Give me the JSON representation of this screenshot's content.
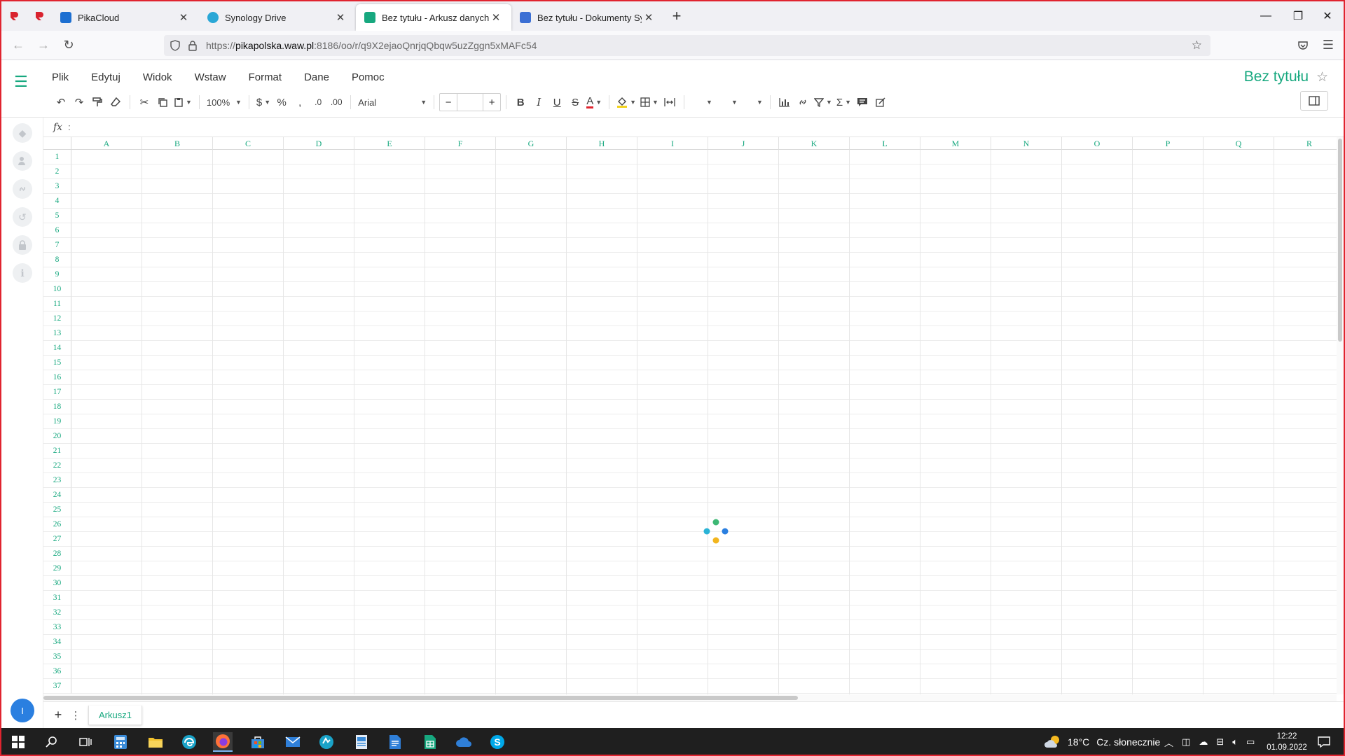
{
  "browser": {
    "tabs": [
      {
        "title": "PikaCloud",
        "fav_color": "#1d6fd1",
        "active": false
      },
      {
        "title": "Synology Drive",
        "fav_color": "#2aa7d6",
        "active": false
      },
      {
        "title": "Bez tytułu - Arkusz danych Synology",
        "fav_color": "#17a87f",
        "active": true
      },
      {
        "title": "Bez tytułu - Dokumenty Synology",
        "fav_color": "#3b6fd4",
        "active": false
      }
    ],
    "url_prefix": "https://",
    "url_host": "pikapolska.waw.pl",
    "url_rest": ":8186/oo/r/q9X2ejaoQnrjqQbqw5uzZggn5xMAFc54"
  },
  "app": {
    "menu": [
      "Plik",
      "Edytuj",
      "Widok",
      "Wstaw",
      "Format",
      "Dane",
      "Pomoc"
    ],
    "doc_title": "Bez tytułu",
    "accent_color": "#17a87f",
    "toolbar": {
      "zoom": "100%",
      "currency": "$",
      "percent": "%",
      "comma": ",",
      "dec_decrease": ".0",
      "dec_increase": ".00",
      "font": "Arial",
      "font_size": ""
    },
    "formula": {
      "label": "fx",
      "colon": ":"
    },
    "columns": [
      "A",
      "B",
      "C",
      "D",
      "E",
      "F",
      "G",
      "H",
      "I",
      "J",
      "K",
      "L",
      "M",
      "N",
      "O",
      "P",
      "Q",
      "R"
    ],
    "rows": [
      "1",
      "2",
      "3",
      "4",
      "5",
      "6",
      "7",
      "8",
      "9",
      "10",
      "11",
      "12",
      "13",
      "14",
      "15",
      "16",
      "17",
      "18",
      "19",
      "20",
      "21",
      "22",
      "23",
      "24",
      "25",
      "26",
      "27",
      "28",
      "29",
      "30",
      "31",
      "32",
      "33",
      "34",
      "35",
      "36",
      "37"
    ],
    "sheet_name": "Arkusz1",
    "user_initial": "I",
    "spinner_colors": [
      "#3db874",
      "#2a7fe0",
      "#f2b51d",
      "#2ab3d6"
    ]
  },
  "taskbar": {
    "weather_temp": "18°C",
    "weather_text": "Cz. słonecznie",
    "time": "12:22",
    "date": "01.09.2022"
  }
}
